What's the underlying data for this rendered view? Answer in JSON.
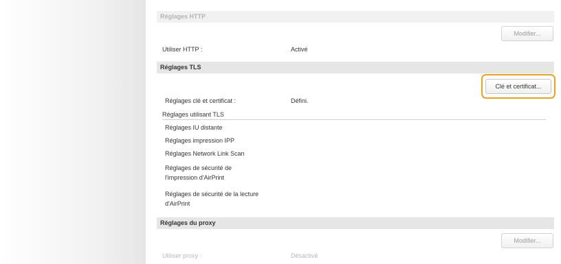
{
  "http": {
    "header": "Réglages HTTP",
    "modify_label": "Modifier...",
    "use_label": "Utiliser HTTP :",
    "use_value": "Activé"
  },
  "tls": {
    "header": "Réglages TLS",
    "key_cert_button": "Clé et certificat...",
    "key_cert_label": "Réglages clé et certificat :",
    "key_cert_value": "Défini.",
    "using_title": "Réglages utilisant TLS",
    "items": [
      "Réglages IU distante",
      "Réglages impression IPP",
      "Réglages Network Link Scan",
      "Réglages de sécurité de",
      "l'impression d'AirPrint",
      "Réglages de sécurité de la lecture",
      "d'AirPrint"
    ]
  },
  "proxy": {
    "header": "Réglages du proxy",
    "modify_label": "Modifier...",
    "use_label": "Utiliser proxy :",
    "use_value": "Désactivé"
  },
  "colors": {
    "highlight": "#f2a01a",
    "header_bg": "#e6e6e6"
  }
}
